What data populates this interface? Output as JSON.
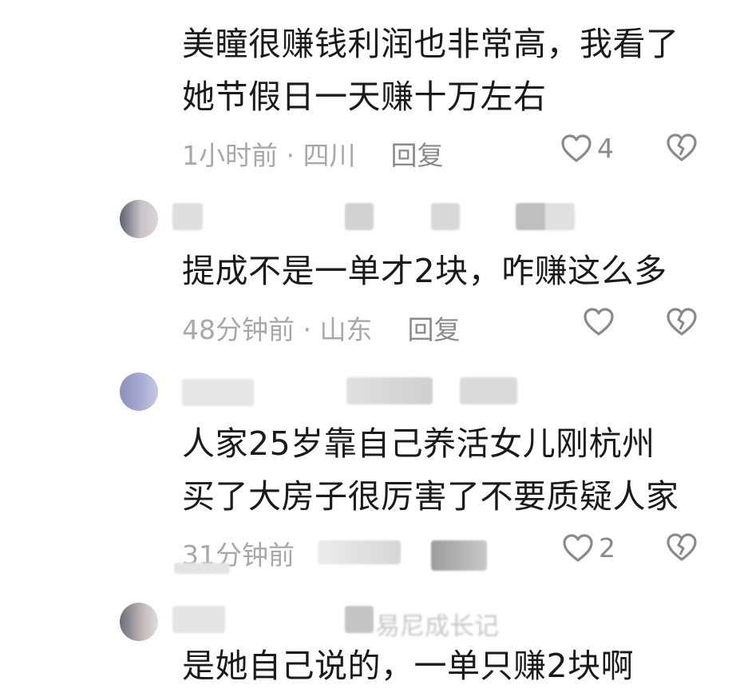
{
  "comments": [
    {
      "lines": [
        "美瞳很赚钱利润也非常高，我看了",
        "她节假日一天赚十万左右"
      ],
      "time": "1小时前 · 四川",
      "reply": "回复",
      "likes": "4"
    },
    {
      "lines": [
        "提成不是一单才2块，咋赚这么多"
      ],
      "time": "48分钟前 · 山东",
      "reply": "回复",
      "likes": ""
    },
    {
      "lines": [
        "人家25岁靠自己养活女儿刚杭州",
        "买了大房子很厉害了不要质疑人家"
      ],
      "time": "31分钟前",
      "reply": "",
      "likes": "2"
    }
  ],
  "partial_username": "易尼成长记",
  "partial_last_line": "是她自己说的，一单只赚2块啊",
  "icons": {
    "like": "heart-outline-icon",
    "dislike": "broken-heart-icon"
  },
  "colors": {
    "text": "#1a1a1a",
    "meta": "#a8a8a8",
    "icon": "#8a8a8a"
  }
}
